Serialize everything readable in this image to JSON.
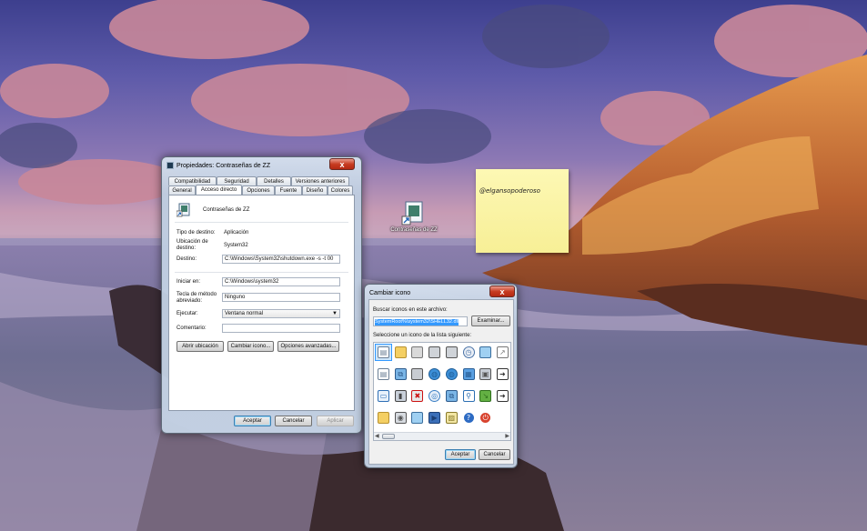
{
  "desktop": {
    "shortcut_label": "Contraseñas de ZZ",
    "sticky_note": "@elgansopoderoso"
  },
  "colors": {
    "accent": "#3399ff",
    "close": "#c73c22",
    "sticky": "#fbf5a3"
  },
  "props": {
    "title": "Propiedades: Contraseñas de ZZ",
    "close_label": "x",
    "tabs_top": [
      "Compatibilidad",
      "Seguridad",
      "Detalles",
      "Versiones anteriores"
    ],
    "tabs_bottom": [
      "General",
      "Acceso directo",
      "Opciones",
      "Fuente",
      "Diseño",
      "Colores"
    ],
    "selected_tab": "Acceso directo",
    "name": "Contraseñas de ZZ",
    "tipo_label": "Tipo de destino:",
    "tipo_value": "Aplicación",
    "ubic_label": "Ubicación de destino:",
    "ubic_value": "System32",
    "destino_label": "Destino:",
    "destino_value": "C:\\Windows\\System32\\shutdown.exe -s -t 00",
    "iniciar_label": "Iniciar en:",
    "iniciar_value": "C:\\Windows\\system32",
    "tecla_label": "Tecla de método abreviado:",
    "tecla_value": "Ninguno",
    "ejecutar_label": "Ejecutar:",
    "ejecutar_value": "Ventana normal",
    "comentario_label": "Comentario:",
    "comentario_value": "",
    "btn_abrir": "Abrir ubicación",
    "btn_cambiar": "Cambiar icono...",
    "btn_opciones": "Opciones avanzadas...",
    "btn_aceptar": "Aceptar",
    "btn_cancelar": "Cancelar",
    "btn_aplicar": "Aplicar"
  },
  "change_icon": {
    "title": "Cambiar icono",
    "close_label": "x",
    "buscar_label": "Buscar iconos en este archivo:",
    "file_value": "SystemRoot%\\system32\\SHELL32.dll",
    "examinar": "Examinar...",
    "seleccione_label": "Seleccione un icono de la lista siguiente:",
    "btn_aceptar": "Aceptar",
    "btn_cancelar": "Cancelar",
    "icons": [
      "document-icon",
      "folder-icon",
      "drive-icon",
      "printer-icon",
      "printer-icon",
      "clock-icon",
      "monitor-icon",
      "shortcut-icon",
      "document-icon",
      "network-icon",
      "server-icon",
      "globe-icon",
      "globe-icon",
      "control-panel-icon",
      "cube-icon",
      "arrow-icon",
      "window-icon",
      "device-icon",
      "delete-icon",
      "cdrom-icon",
      "network-icon",
      "search-icon",
      "run-icon",
      "arrow-icon",
      "folder-icon",
      "disk-icon",
      "monitor-icon",
      "media-icon",
      "image-icon",
      "help-icon",
      "power-icon"
    ]
  }
}
